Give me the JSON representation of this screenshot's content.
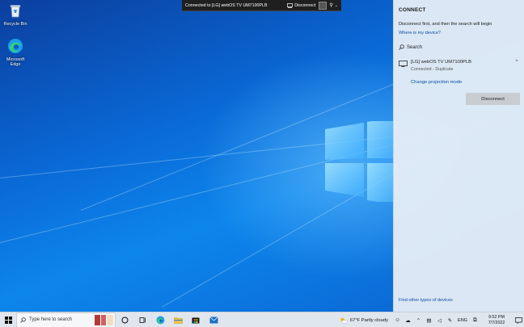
{
  "desktop": {
    "icons": [
      {
        "label": "Recycle Bin"
      },
      {
        "label": "Microsoft Edge"
      }
    ]
  },
  "cast_banner": {
    "title": "Connected to [LG] webOS TV UM7100PLB",
    "disconnect_label": "Disconnect"
  },
  "connect_panel": {
    "header": "CONNECT",
    "info": "Disconnect first, and then the search will begin",
    "where_link": "Where is my device?",
    "search_label": "Search",
    "device": {
      "name": "[LG] webOS TV UM7100PLB",
      "status": "Connected - Duplicate"
    },
    "change_mode_link": "Change projection mode",
    "disconnect_button": "Disconnect",
    "other_devices_link": "Find other types of devices"
  },
  "taskbar": {
    "search_placeholder": "Type here to search",
    "weather": "67°F  Partly cloudy",
    "language": "ENG",
    "time": "9:52 PM",
    "date": "7/7/2022"
  },
  "colors": {
    "accent_link": "#0a4ea3",
    "panel_bg": "#e4ecf6",
    "taskbar_bg": "#dfe6ee"
  }
}
